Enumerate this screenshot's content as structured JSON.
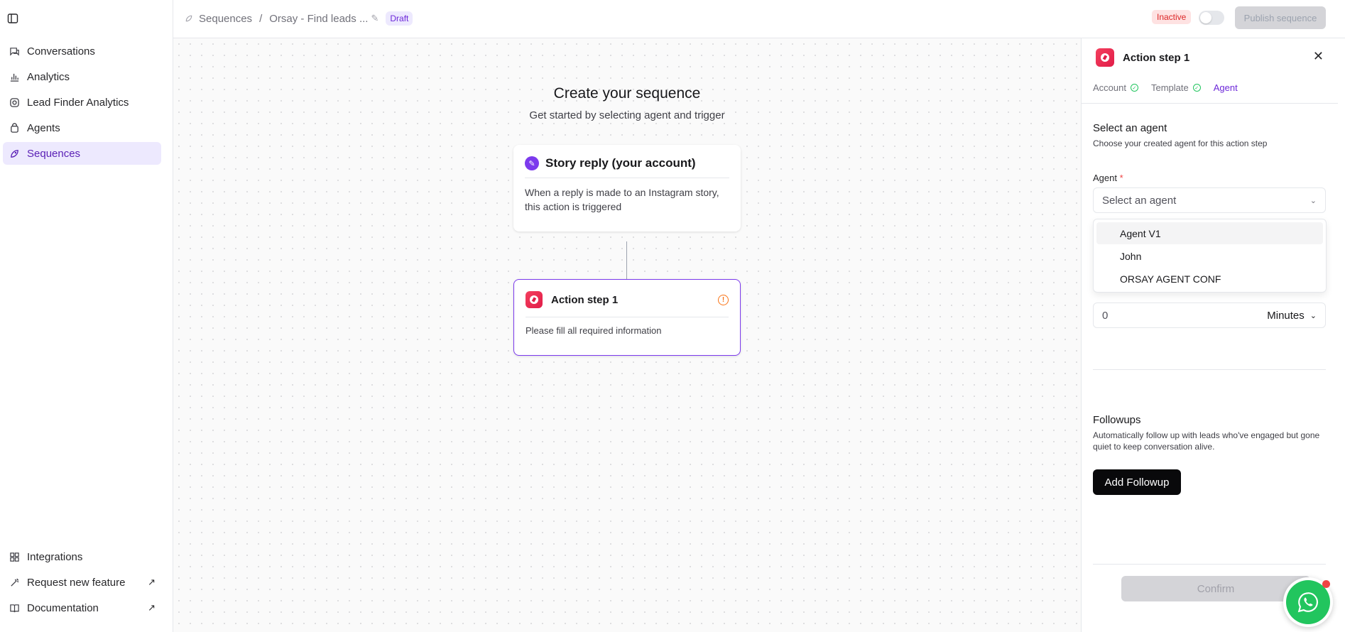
{
  "sidebar": {
    "items": [
      {
        "label": "Conversations"
      },
      {
        "label": "Analytics"
      },
      {
        "label": "Lead Finder Analytics"
      },
      {
        "label": "Agents"
      },
      {
        "label": "Sequences"
      }
    ],
    "bottom": [
      {
        "label": "Integrations"
      },
      {
        "label": "Request new feature"
      },
      {
        "label": "Documentation"
      }
    ]
  },
  "header": {
    "crumb_root": "Sequences",
    "crumb_sep": "/",
    "crumb_current": "Orsay - Find leads ...",
    "draft_badge": "Draft",
    "status_badge": "Inactive",
    "publish_label": "Publish sequence"
  },
  "canvas": {
    "title": "Create your sequence",
    "subtitle": "Get started by selecting agent and trigger",
    "trigger": {
      "title": "Story reply (your account)",
      "description": "When a reply is made to an Instagram story, this action is triggered"
    },
    "action": {
      "title": "Action step 1",
      "description": "Please fill all required information"
    }
  },
  "panel": {
    "title": "Action step 1",
    "tabs": [
      {
        "label": "Account"
      },
      {
        "label": "Template"
      },
      {
        "label": "Agent"
      }
    ],
    "section_title": "Select an agent",
    "section_subtitle": "Choose your created agent for this action step",
    "agent_label": "Agent",
    "agent_required": "*",
    "agent_placeholder": "Select an agent",
    "agent_options": [
      "Agent V1",
      "John",
      "ORSAY AGENT CONF"
    ],
    "delay_value": "0",
    "delay_unit": "Minutes",
    "followups_title": "Followups",
    "followups_subtitle": "Automatically follow up with leads who've engaged but gone quiet to keep conversation alive.",
    "add_followup_label": "Add Followup",
    "confirm_label": "Confirm"
  },
  "colors": {
    "accent": "#7c3aed",
    "app_icon": "#e11d48",
    "whatsapp": "#22c55e"
  }
}
